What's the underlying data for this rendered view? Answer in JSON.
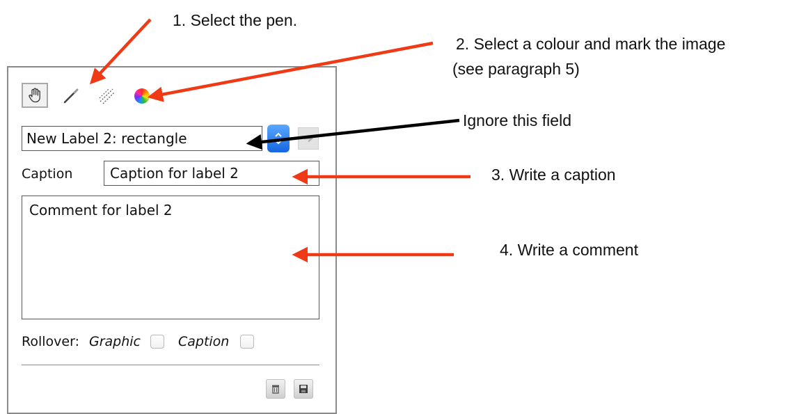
{
  "panel": {
    "tools": [
      {
        "name": "hand-tool",
        "icon": "hand-icon",
        "selected": true
      },
      {
        "name": "pen-tool",
        "icon": "pen-icon"
      },
      {
        "name": "ruler-tool",
        "icon": "ruler-icon"
      },
      {
        "name": "colour-tool",
        "icon": "color-wheel-icon"
      }
    ],
    "label_select": {
      "value": "New Label 2: rectangle"
    },
    "caption": {
      "label": "Caption",
      "value": "Caption for label 2"
    },
    "comment": {
      "value": "Comment for label 2"
    },
    "rollover": {
      "label": "Rollover:",
      "graphic_label": "Graphic",
      "caption_label": "Caption"
    }
  },
  "annotations": {
    "step1": "1. Select the pen.",
    "step2_line1": "2. Select a colour and mark the image",
    "step2_line2": "(see paragraph 5)",
    "ignore": "Ignore this field",
    "step3": "3. Write a caption",
    "step4": "4. Write a comment"
  },
  "colors": {
    "arrow_red": "#f03a16",
    "arrow_black": "#000000",
    "accent_blue": "#1b73f0"
  }
}
